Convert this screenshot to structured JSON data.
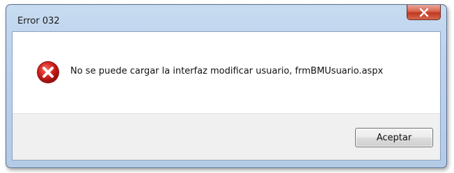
{
  "dialog": {
    "title": "Error 032",
    "message": "No se puede cargar la interfaz modificar usuario, frmBMUsuario.aspx",
    "ok_label": "Aceptar",
    "icon": "error-icon"
  },
  "colors": {
    "close_button": "#c73c22",
    "error_icon": "#d11f1f",
    "footer_background": "#f0f0f0"
  }
}
